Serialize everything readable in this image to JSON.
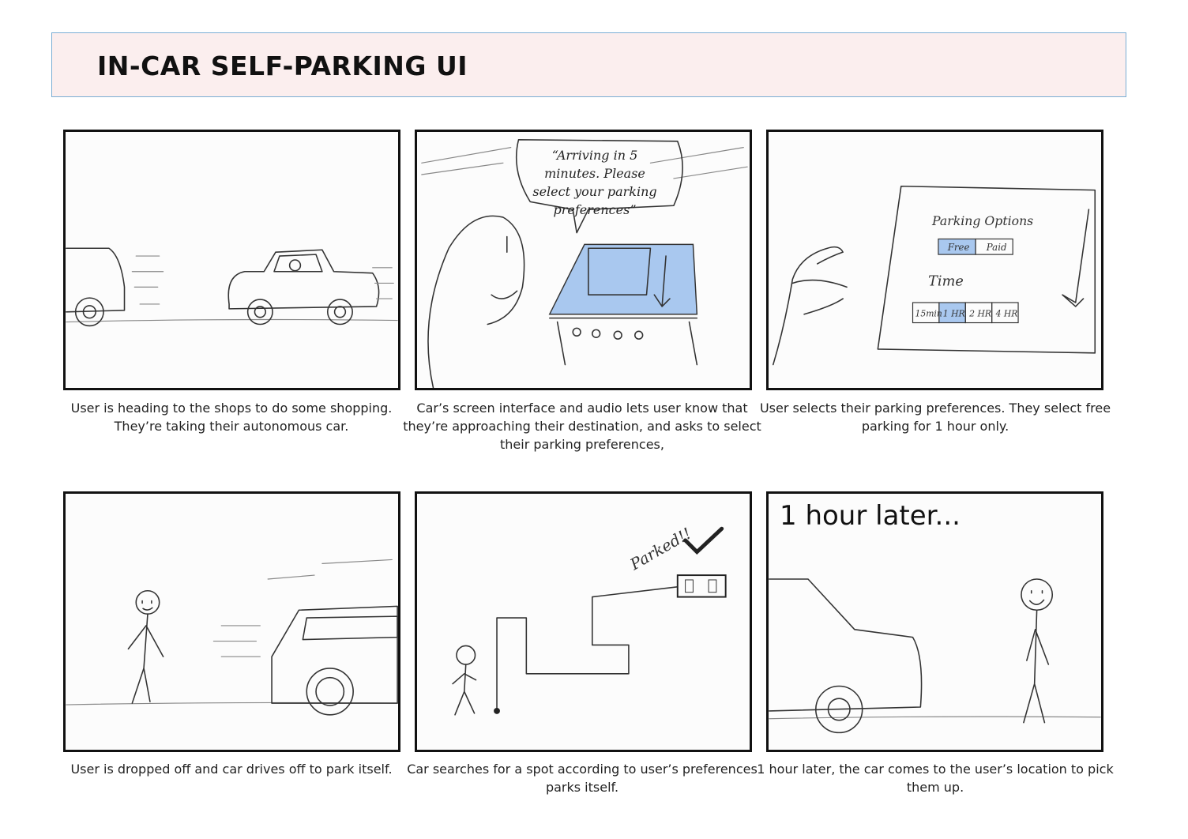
{
  "header": {
    "title": "IN-CAR SELF-PARKING UI"
  },
  "panels": [
    {
      "caption": "User is heading to the shops to do some shopping. They’re taking their autonomous car."
    },
    {
      "caption": "Car’s screen interface and audio lets user know that they’re approaching their destination, and asks to select their parking preferences,",
      "speech": "“Arriving in 5 minutes. Please select your parking preferences”"
    },
    {
      "caption": "User selects their parking preferences. They select free parking for 1 hour only.",
      "screen": {
        "title": "Parking Options",
        "options": [
          "Free",
          "Paid"
        ],
        "time_label": "Time",
        "durations": [
          "15min",
          "1 HR",
          "2 HR",
          "4 HR"
        ]
      }
    },
    {
      "caption": "User is dropped off and car drives off to park itself."
    },
    {
      "caption": "Car searches for a spot according to user’s preferences parks itself.",
      "note": "Parked!!"
    },
    {
      "caption": "1 hour later, the car comes to the user’s location to pick them up.",
      "overlay": "1 hour later..."
    }
  ],
  "colors": {
    "title_bg": "#fbeeee",
    "title_border": "#7aaed4",
    "screen_fill": "#a9c8ef"
  }
}
